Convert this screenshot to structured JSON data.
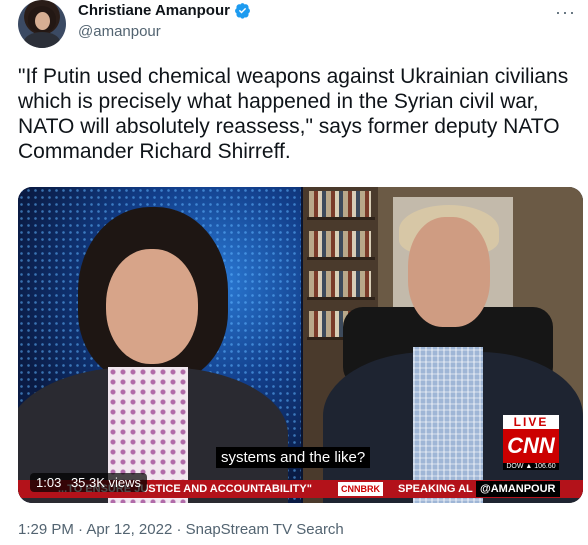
{
  "author": {
    "name": "Christiane Amanpour",
    "handle": "@amanpour"
  },
  "tweet": {
    "text": "\"If Putin used chemical weapons against Ukrainian civilians which is precisely what happened in the Syrian civil war, NATO will absolutely reassess,\" says former deputy NATO Commander Richard Shirreff."
  },
  "video": {
    "caption": "systems and the like?",
    "time": "1:03",
    "views": "35.3K views",
    "live_label": "LIVE",
    "network": "CNN",
    "dow": "DOW ▲ 106.60",
    "ticker_left": "...TO ENSURE JUSTICE AND ACCOUNTABILITY\"",
    "ticker_tag": "CNNBRK",
    "ticker_right": "SPEAKING AL",
    "ticker_handle": "@AMANPOUR"
  },
  "meta": {
    "time": "1:29 PM",
    "date": "Apr 12, 2022",
    "source": "SnapStream TV Search",
    "line": "1:29 PM · Apr 12, 2022 · SnapStream TV Search"
  },
  "menu_icon": "more-icon",
  "accent": "#1d9bf0"
}
